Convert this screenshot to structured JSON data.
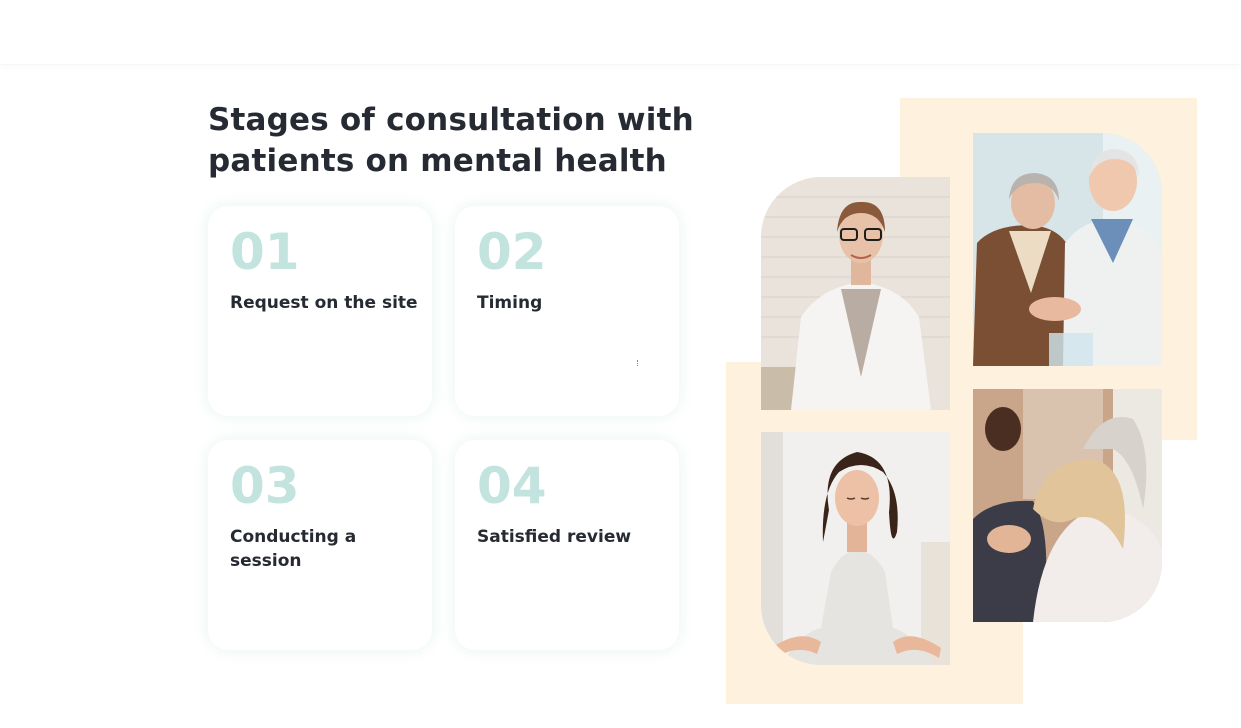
{
  "section": {
    "title_line1": "Stages of consultation with",
    "title_line2": "patients on mental health"
  },
  "steps": [
    {
      "number": "01",
      "label": "Request on the site"
    },
    {
      "number": "02",
      "label": "Timing"
    },
    {
      "number": "03",
      "label": "Conducting a session"
    },
    {
      "number": "04",
      "label": "Satisfied review"
    }
  ],
  "colors": {
    "accent_number": "#c3e3de",
    "heading": "#262a33",
    "beige_backdrop": "#fef2de"
  },
  "images": [
    {
      "name": "psychologist-photo"
    },
    {
      "name": "elderly-couple-photo"
    },
    {
      "name": "meditation-photo"
    },
    {
      "name": "group-support-photo"
    }
  ]
}
